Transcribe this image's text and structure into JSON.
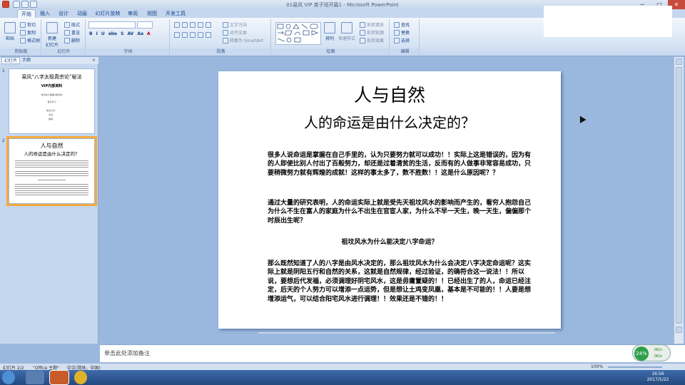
{
  "window": {
    "title": "01易风 VIP 弟子班开篇1 - Microsoft PowerPoint",
    "minimize": "─",
    "maximize": "□",
    "close": "✕"
  },
  "tabs": [
    "开始",
    "插入",
    "设计",
    "动画",
    "幻灯片放映",
    "审阅",
    "视图",
    "开发工具"
  ],
  "ribbon": {
    "clipboard": {
      "label": "剪贴板",
      "paste": "粘贴",
      "cut": "剪切",
      "copy": "复制",
      "format_painter": "格式刷"
    },
    "slides": {
      "label": "幻灯片",
      "new_slide": "新建\n幻灯片",
      "layout": "版式",
      "reset": "重设",
      "delete": "删除"
    },
    "font": {
      "label": "字体",
      "bold": "B",
      "italic": "I",
      "underline": "U",
      "strike": "abe",
      "shadow": "S",
      "spacing": "AV",
      "case": "Aa",
      "color": "A"
    },
    "paragraph": {
      "label": "段落",
      "text_direction": "文字方向",
      "align_text": "对齐文本",
      "smartart": "转换为 SmartArt"
    },
    "drawing": {
      "label": "绘图",
      "arrange": "排列",
      "quick_styles": "快速样式",
      "fill": "形状填充",
      "outline": "形状轮廓",
      "effects": "形状效果"
    },
    "editing": {
      "label": "编辑",
      "find": "查找",
      "replace": "替换",
      "select": "选择"
    }
  },
  "leftpane": {
    "tab_slides": "幻灯片",
    "tab_outline": "大纲",
    "close": "×",
    "slide1": {
      "num": "1",
      "title": "易风“八字太极真宗论”秘法",
      "sub": "VIP内部资料",
      "line1": "易风弟子课程内部资料",
      "line2": "每日学习",
      "line3": "联系方式：",
      "line4": "手机：",
      "line5": "邮箱："
    },
    "slide2": {
      "num": "2",
      "title": "人与自然",
      "sub": "人的命运是由什么决定的？"
    }
  },
  "slide": {
    "title": "人与自然",
    "subtitle": "人的命运是由什么决定的？",
    "para1": "很多人说命运是掌握在自己手里的，认为只要努力就可以成功！！实际上这是错误的，因为有的人即使比别人付出了百般努力，却还是过着清贫的生活，反而有的人做事非常容易成功，只要稍微努力就有辉煌的成就！这样的事太多了，数不胜数！！这是什么原因呢？？",
    "para2": "通过大量的研究表明，人的命运实际上就是受先天祖坟风水的影响而产生的，看穷人抱怨自己为什么不生在富人的家庭为什么不出生在官宦人家，为什么不早一天生，晚一天生，偏偏那个时辰出生呢？",
    "para3": "祖坟风水为什么能决定八字命运？",
    "para4": "那么既然知道了人的八字是由风水决定的，那么祖坟风水为什么会决定八字决定命运呢？这实际上就是阴阳五行和自然的关系，这就是自然规律，经过验证，的确符合这一说法！！所以说，要想后代发福，必须调理好阴宅风水，这是毋庸置疑的！！已经出生了的人，命运已经注定，后天的个人努力可以增添一点运势，但是想让土鸡变凤凰，基本是不可能的！！人要是想增添运气，可以结合阳宅风水进行调理！！效果还是不错的！！"
  },
  "notes": {
    "placeholder": "单击此处添加备注"
  },
  "status": {
    "slide": "幻灯片 2/2",
    "theme": "\"Office 主题\"",
    "lang": "中文(简体，中国)",
    "zoom": "100%"
  },
  "netmon": {
    "percent": "24%",
    "up": "0K/s",
    "down": "0K/s"
  },
  "clock": {
    "time": "16:56",
    "date": "2017/5/22"
  }
}
